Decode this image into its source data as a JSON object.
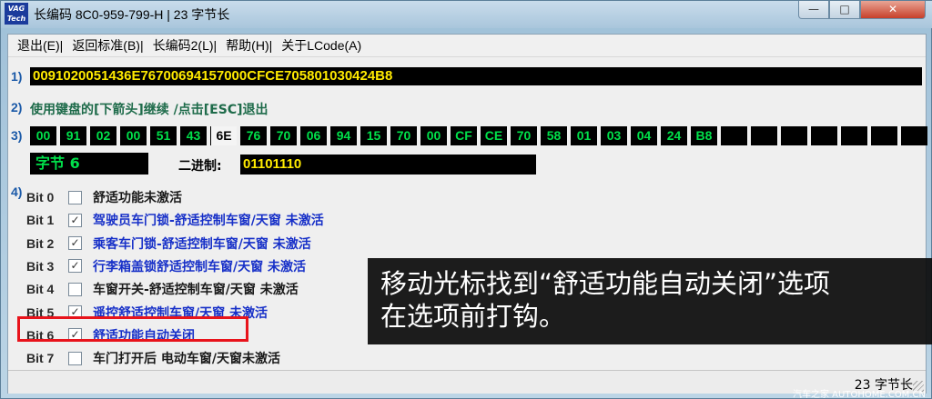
{
  "window": {
    "icon_text": "VAG Tech",
    "title": "长编码  8C0-959-799-H | 23 字节长",
    "min_symbol": "—",
    "max_symbol": "□",
    "close_symbol": "✕"
  },
  "menu": {
    "items": [
      "退出(E)|",
      "返回标准(B)|",
      "长编码2(L)|",
      "帮助(H)|",
      "关于LCode(A)"
    ]
  },
  "section1": {
    "num": "1)",
    "hex": "0091020051436E76700694157000CFCE705801030424B8"
  },
  "section2": {
    "num": "2)",
    "text": "使用键盘的[下箭头]继续 /点击[ESC]退出"
  },
  "section3": {
    "num": "3)",
    "bytes": [
      "00",
      "91",
      "02",
      "00",
      "51",
      "43",
      "6E",
      "76",
      "70",
      "06",
      "94",
      "15",
      "70",
      "00",
      "CF",
      "CE",
      "70",
      "58",
      "01",
      "03",
      "04",
      "24",
      "B8",
      "",
      "",
      "",
      "",
      "",
      "",
      ""
    ],
    "selected_index": 6,
    "byte_label": "字节 6",
    "binary_label": "二进制:",
    "binary_value": "01101110"
  },
  "section4": {
    "num": "4)",
    "bits": [
      {
        "name": "Bit 0",
        "checked": false,
        "check": "",
        "desc": "舒适功能未激活"
      },
      {
        "name": "Bit 1",
        "checked": true,
        "check": "✓",
        "desc": "驾驶员车门锁-舒适控制车窗/天窗 未激活"
      },
      {
        "name": "Bit 2",
        "checked": true,
        "check": "✓",
        "desc": "乘客车门锁-舒适控制车窗/天窗 未激活"
      },
      {
        "name": "Bit 3",
        "checked": true,
        "check": "✓",
        "desc": "行李箱盖锁舒适控制车窗/天窗 未激活"
      },
      {
        "name": "Bit 4",
        "checked": false,
        "check": "",
        "desc": "车窗开关-舒适控制车窗/天窗 未激活"
      },
      {
        "name": "Bit 5",
        "checked": true,
        "check": "✓",
        "desc": "遥控舒适控制车窗/天窗 未激活"
      },
      {
        "name": "Bit 6",
        "checked": true,
        "check": "✓",
        "desc": "舒适功能自动关闭"
      },
      {
        "name": "Bit 7",
        "checked": false,
        "check": "",
        "desc": "车门打开后 电动车窗/天窗未激活"
      }
    ]
  },
  "status": {
    "text": "23 字节长"
  },
  "overlay": {
    "line1": "移动光标找到“舒适功能自动关闭”选项",
    "line2": "在选项前打钩。"
  },
  "watermark": "汽车之家 AUTOHOME.COM.CN"
}
